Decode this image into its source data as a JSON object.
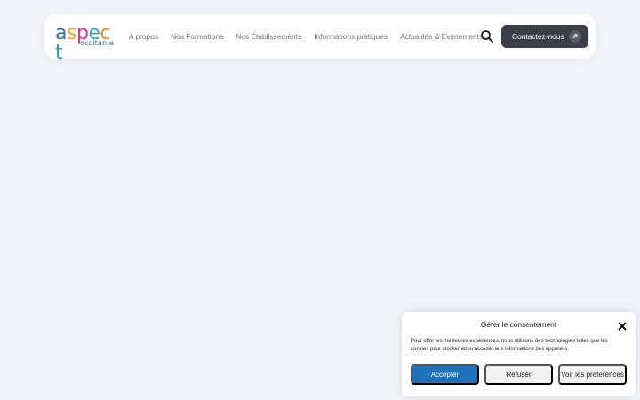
{
  "header": {
    "logo": {
      "word": "aspect",
      "sub": "occitanie",
      "letter_colors": [
        "#2f6fb6",
        "#f2a51a",
        "#e8308a",
        "#36a7c9",
        "#f08a24",
        "#1ea0c9"
      ]
    },
    "nav": [
      {
        "label": "A propos"
      },
      {
        "label": "Nos Formations"
      },
      {
        "label": "Nos Établissements"
      },
      {
        "label": "Informations pratiques"
      },
      {
        "label": "Actualités & Événements"
      }
    ],
    "search_icon": "search-icon",
    "contact_label": "Contactez-nous",
    "contact_icon": "arrow-up-right-icon"
  },
  "consent": {
    "title": "Gérer le consentement",
    "text": "Pour offrir les meilleures expériences, nous utilisons des technologies telles que les cookies pour stocker et/ou accéder aux informations des appareils.",
    "accept_label": "Accepter",
    "refuse_label": "Refuser",
    "prefs_label": "Voir les préférences",
    "close_icon": "close-icon"
  },
  "colors": {
    "background": "#f1f4f9",
    "button_dark": "#3a3e48",
    "accept_blue": "#1e73be"
  }
}
